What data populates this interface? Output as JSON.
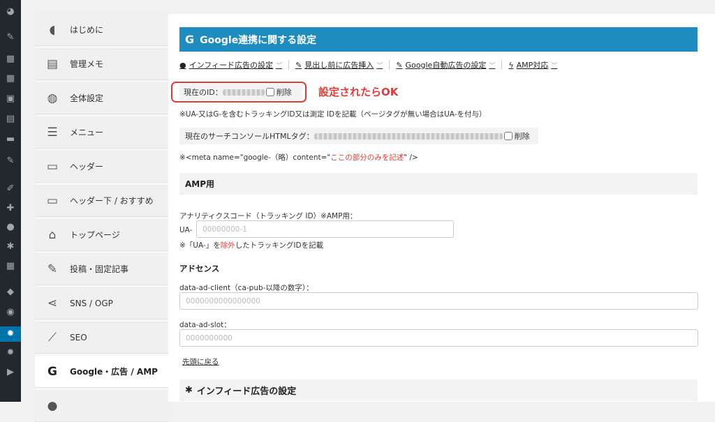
{
  "admin_bar": {
    "icons": [
      "dashboard-icon",
      "pin-icon",
      "grid-icon",
      "grid-icon",
      "media-icon",
      "pages-icon",
      "comments-icon",
      "pin-icon",
      "brush-icon",
      "plugin-icon",
      "users-icon",
      "tools-icon",
      "table-icon",
      "layers-icon",
      "wp-icon",
      "settings-icon",
      "gear-icon",
      "play-icon"
    ]
  },
  "sidebar": {
    "items": [
      {
        "label": "はじめに",
        "icon": "beginner-icon"
      },
      {
        "label": "管理メモ",
        "icon": "memo-icon"
      },
      {
        "label": "全体設定",
        "icon": "palette-icon"
      },
      {
        "label": "メニュー",
        "icon": "menu-icon"
      },
      {
        "label": "ヘッダー",
        "icon": "header-icon"
      },
      {
        "label": "ヘッダー下 / おすすめ",
        "icon": "header-below-icon"
      },
      {
        "label": "トップページ",
        "icon": "home-icon"
      },
      {
        "label": "投稿・固定記事",
        "icon": "edit-icon"
      },
      {
        "label": "SNS / OGP",
        "icon": "share-icon"
      },
      {
        "label": "SEO",
        "icon": "chart-icon"
      },
      {
        "label": "Google・広告 / AMP",
        "icon": "google-icon"
      }
    ]
  },
  "panel": {
    "title": "Google連携に関する設定",
    "title_icon": "G",
    "tabs": [
      {
        "label": "インフィード広告の設定"
      },
      {
        "label": "見出し前に広告挿入"
      },
      {
        "label": "Google自動広告の設定"
      },
      {
        "label": "AMP対応"
      }
    ],
    "current_id_label": "現在のID：",
    "delete_label": "削除",
    "annotation": "設定されたらOK",
    "id_note": "※UA-又はG-を含むトラッキングID又は測定 IDを記載（ページタグが無い場合はUA-を付与）",
    "search_console_label": "現在のサーチコンソールHTMLタグ：",
    "meta_note_prefix": "※<meta name=\"google-（略）content=\"",
    "meta_note_red": "ここの部分のみを記述",
    "meta_note_suffix": "\" />",
    "amp_section": "AMP用",
    "analytics_label": "アナリティクスコード（トラッキング ID）※AMP用：",
    "ua_prefix": "UA-",
    "ua_placeholder": "00000000-1",
    "ua_note_prefix": "※「UA-」を",
    "ua_note_red": "除外",
    "ua_note_suffix": "したトラッキングIDを記載",
    "adsense_heading": "アドセンス",
    "ad_client_label": "data-ad-client（ca-pub-以降の数字）：",
    "ad_client_placeholder": "0000000000000000",
    "ad_slot_label": "data-ad-slot：",
    "ad_slot_placeholder": "0000000000",
    "back_to_top": "先頭に戻る",
    "infeed_section": "インフィード広告の設定"
  },
  "colors": {
    "title_bar": "#1e8cbe",
    "annotation_red": "#e53935",
    "admin_bar": "#23282d",
    "admin_active": "#0073aa"
  }
}
